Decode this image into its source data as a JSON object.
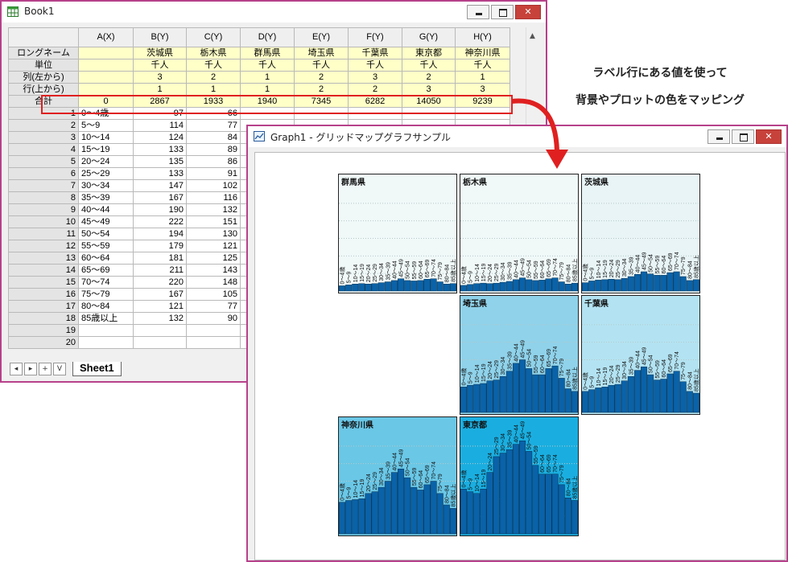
{
  "book": {
    "title": "Book1",
    "columns": [
      "A(X)",
      "B(Y)",
      "C(Y)",
      "D(Y)",
      "E(Y)",
      "F(Y)",
      "G(Y)",
      "H(Y)"
    ],
    "meta_rows": [
      {
        "label": "ロングネーム",
        "values": [
          "",
          "茨城県",
          "栃木県",
          "群馬県",
          "埼玉県",
          "千葉県",
          "東京都",
          "神奈川県"
        ]
      },
      {
        "label": "単位",
        "values": [
          "",
          "千人",
          "千人",
          "千人",
          "千人",
          "千人",
          "千人",
          "千人"
        ]
      },
      {
        "label": "列(左から)",
        "values": [
          "",
          "3",
          "2",
          "1",
          "2",
          "3",
          "2",
          "1"
        ]
      },
      {
        "label": "行(上から)",
        "values": [
          "",
          "1",
          "1",
          "1",
          "2",
          "2",
          "3",
          "3"
        ]
      },
      {
        "label": "合計",
        "values": [
          "0",
          "2867",
          "1933",
          "1940",
          "7345",
          "6282",
          "14050",
          "9239"
        ]
      }
    ],
    "data_rows": [
      {
        "n": "1",
        "a": "0～4歳",
        "b": "97",
        "c": "66"
      },
      {
        "n": "2",
        "a": "5～9",
        "b": "114",
        "c": "77"
      },
      {
        "n": "3",
        "a": "10～14",
        "b": "124",
        "c": "84"
      },
      {
        "n": "4",
        "a": "15～19",
        "b": "133",
        "c": "89"
      },
      {
        "n": "5",
        "a": "20～24",
        "b": "135",
        "c": "86"
      },
      {
        "n": "6",
        "a": "25～29",
        "b": "133",
        "c": "91"
      },
      {
        "n": "7",
        "a": "30～34",
        "b": "147",
        "c": "102"
      },
      {
        "n": "8",
        "a": "35～39",
        "b": "167",
        "c": "116"
      },
      {
        "n": "9",
        "a": "40～44",
        "b": "190",
        "c": "132"
      },
      {
        "n": "10",
        "a": "45～49",
        "b": "222",
        "c": "151"
      },
      {
        "n": "11",
        "a": "50～54",
        "b": "194",
        "c": "130"
      },
      {
        "n": "12",
        "a": "55～59",
        "b": "179",
        "c": "121"
      },
      {
        "n": "13",
        "a": "60～64",
        "b": "181",
        "c": "125"
      },
      {
        "n": "14",
        "a": "65～69",
        "b": "211",
        "c": "143"
      },
      {
        "n": "15",
        "a": "70～74",
        "b": "220",
        "c": "148"
      },
      {
        "n": "16",
        "a": "75～79",
        "b": "167",
        "c": "105"
      },
      {
        "n": "17",
        "a": "80～84",
        "b": "121",
        "c": "77"
      },
      {
        "n": "18",
        "a": "85歳以上",
        "b": "132",
        "c": "90"
      },
      {
        "n": "19",
        "a": "",
        "b": "",
        "c": ""
      },
      {
        "n": "20",
        "a": "",
        "b": "",
        "c": ""
      }
    ],
    "sheet_tab": "Sheet1",
    "nav_buttons": [
      "◂",
      "▸",
      "+",
      "V"
    ]
  },
  "annotation": {
    "line1": "ラベル行にある値を使って",
    "line2": "背景やプロットの色をマッピング"
  },
  "graph": {
    "title": "Graph1 - グリッドマップグラフサンプル",
    "age_labels": [
      "0～4歳",
      "5～9",
      "10～14",
      "15～19",
      "20～24",
      "25～29",
      "30～34",
      "35～39",
      "40～44",
      "45～49",
      "50～54",
      "55～59",
      "60～64",
      "65～69",
      "70～74",
      "75～79",
      "80～84",
      "85歳以上"
    ],
    "panels": [
      {
        "name": "群馬県",
        "col": 1,
        "row": 1,
        "bg": "#f0f8f8",
        "values": [
          0.6,
          0.7,
          0.8,
          0.85,
          0.8,
          0.85,
          0.95,
          1.05,
          1.2,
          1.4,
          1.2,
          1.15,
          1.2,
          1.35,
          1.4,
          1.05,
          0.8,
          0.85
        ]
      },
      {
        "name": "栃木県",
        "col": 2,
        "row": 1,
        "bg": "#f0f8f8",
        "values": [
          0.65,
          0.75,
          0.85,
          0.9,
          0.85,
          0.9,
          1.0,
          1.1,
          1.3,
          1.5,
          1.3,
          1.2,
          1.25,
          1.4,
          1.5,
          1.05,
          0.8,
          0.9
        ]
      },
      {
        "name": "茨城県",
        "col": 3,
        "row": 1,
        "bg": "#e8f4f6",
        "values": [
          0.95,
          1.15,
          1.25,
          1.3,
          1.35,
          1.3,
          1.45,
          1.65,
          1.9,
          2.2,
          1.95,
          1.8,
          1.8,
          2.1,
          2.2,
          1.65,
          1.2,
          1.3
        ]
      },
      {
        "name": "埼玉県",
        "col": 2,
        "row": 2,
        "bg": "#8fd2ea",
        "values": [
          2.9,
          3.1,
          3.2,
          3.3,
          3.6,
          3.7,
          4.1,
          4.7,
          5.6,
          6.0,
          5.0,
          4.3,
          4.3,
          5.0,
          5.3,
          3.9,
          2.7,
          2.4
        ]
      },
      {
        "name": "千葉県",
        "col": 3,
        "row": 2,
        "bg": "#b3e3f2",
        "values": [
          2.4,
          2.6,
          2.8,
          2.9,
          3.1,
          3.2,
          3.6,
          4.1,
          4.8,
          5.2,
          4.3,
          3.7,
          3.8,
          4.4,
          4.7,
          3.5,
          2.4,
          2.2
        ]
      },
      {
        "name": "神奈川県",
        "col": 1,
        "row": 3,
        "bg": "#6ac7e6",
        "values": [
          3.6,
          3.8,
          3.9,
          4.0,
          4.6,
          4.8,
          5.3,
          6.0,
          7.0,
          7.4,
          6.4,
          5.3,
          5.0,
          5.6,
          6.0,
          4.6,
          3.3,
          2.9
        ]
      },
      {
        "name": "東京都",
        "col": 2,
        "row": 3,
        "bg": "#1aaee0",
        "values": [
          5.1,
          4.8,
          4.6,
          5.1,
          7.0,
          8.8,
          9.2,
          9.6,
          10.2,
          10.6,
          9.4,
          7.8,
          6.8,
          6.8,
          6.8,
          5.6,
          4.1,
          3.8
        ]
      }
    ]
  },
  "colors": {
    "window_border": "#b7418b",
    "bar_fill": "#0a62a8",
    "highlight": "#e02020",
    "arrow": "#e02020"
  }
}
